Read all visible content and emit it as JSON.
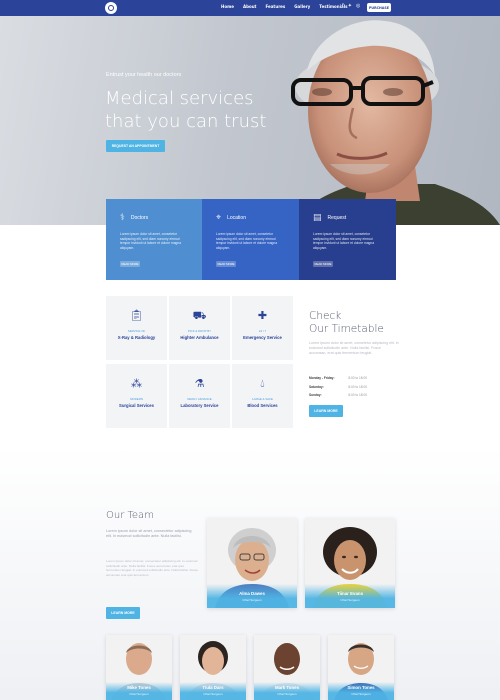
{
  "header": {
    "nav": [
      "Home",
      "About",
      "Features",
      "Gallery",
      "Testimonials"
    ],
    "purchase_label": "PURCHASE"
  },
  "hero": {
    "subtitle": "Entrust your health our doctors",
    "title_line1": "Medical services",
    "title_line2": "that you can trust",
    "cta_label": "REQUEST AN APPOINTMENT"
  },
  "info_cards": [
    {
      "title": "Doctors",
      "text": "Lorem ipsum dolor sit amet, consetetur sadipscing elit, sed diam nonumy eirmod tempor invidunt ut labore et dolore magna aliquyam.",
      "button": "READ MORE"
    },
    {
      "title": "Location",
      "text": "Lorem ipsum dolor sit amet, consetetur sadipscing elit, sed diam nonumy eirmod tempor invidunt ut labore et dolore magna aliquyam.",
      "button": "READ MORE"
    },
    {
      "title": "Request",
      "text": "Lorem ipsum dolor sit amet, consetetur sadipscing elit, sed diam nonumy eirmod tempor invidunt ut labore et dolore magna aliquyam.",
      "button": "READ MORE"
    }
  ],
  "services": [
    {
      "tag": "SERVICE OF",
      "name": "X-Ray & Radiology",
      "icon": "clipboard-icon"
    },
    {
      "tag": "PICK & DROP BY",
      "name": "Highter Ambulance",
      "icon": "ambulance-icon"
    },
    {
      "tag": "24 / 7",
      "name": "Emergency Service",
      "icon": "medical-cross-icon"
    },
    {
      "tag": "MODERN",
      "name": "Surgical Services",
      "icon": "molecule-icon"
    },
    {
      "tag": "NEWLY ADVANCE",
      "name": "Laboratory Service",
      "icon": "flask-icon"
    },
    {
      "tag": "LARGE & SAFE",
      "name": "Blood Services",
      "icon": "blood-drop-icon"
    }
  ],
  "timetable": {
    "title_line1": "Check",
    "title_line2": "Our Timetable",
    "text": "Lorem ipsum dolor sit amet, consetetur adipiscing elit. In euismod sollicitudin ante. Nulla facilisi. Fusce accumsan, erat quis fermentum feugiat.",
    "rows": [
      {
        "day": "Monday - Friday:",
        "hours": "8:00 to 18:00"
      },
      {
        "day": "Saturday:",
        "hours": "8:00 to 18:00"
      },
      {
        "day": "Sunday:",
        "hours": "8:00 to 18:00"
      }
    ],
    "button": "LEARN MORE"
  },
  "team": {
    "title": "Our Team",
    "intro": "Lorem ipsum dolor sit amet, consectetur adipiscing elit. In euismod sollicitudin ante. Nulla facilisi.",
    "text": "Lorem ipsum dolor sit amet, consectetur adipiscing elit. In euismod sollicitudin ante. Nulla facilisi. Fusce accumsan, erat quis fermentum feugiat. In euismod sollicitudin ante. Nulla facilisi. Fusce accumsan erat quis fermentum.",
    "button": "LEARN MORE",
    "featured": [
      {
        "name": "Alma Dawes",
        "role": "Chief Surgeon"
      },
      {
        "name": "Tiinar Evans",
        "role": "Chief Surgeon"
      }
    ],
    "members": [
      {
        "name": "Mike Tones",
        "role": "Chief Surgeon"
      },
      {
        "name": "Tiula Dars",
        "role": "Chief Surgeon"
      },
      {
        "name": "Mark Tones",
        "role": "Chief Surgeon"
      },
      {
        "name": "Simon Tones",
        "role": "Chief Surgeon"
      }
    ]
  },
  "colors": {
    "brand": "#2b4399",
    "accent": "#4fb4e4"
  }
}
